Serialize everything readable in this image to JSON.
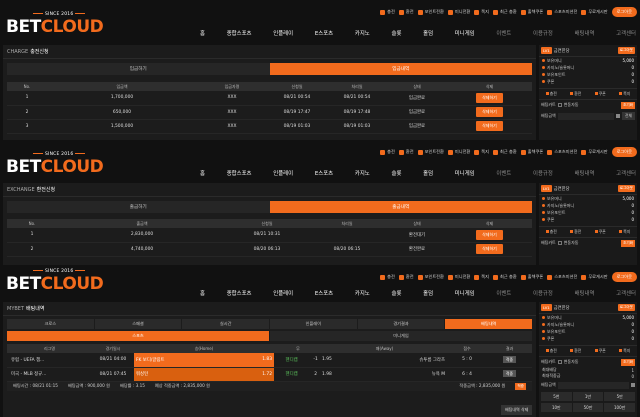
{
  "topbar": {
    "items": [
      "충전",
      "환전",
      "포인트전환",
      "미니전환",
      "쪽지",
      "최근 충환",
      "출첵쿠폰",
      "스포츠미션전",
      "무료게시판"
    ],
    "login": "로그아웃"
  },
  "logo": {
    "since": "SINCE 2016",
    "bet": "BET",
    "cloud": "CLOUD"
  },
  "nav": [
    "홈",
    "종합스포츠",
    "인플레이",
    "E스포츠",
    "카지노",
    "슬롯",
    "홀덤",
    "미니게임",
    "이벤트",
    "이용규정",
    "배팅내역",
    "고객센터"
  ],
  "section1": {
    "title_en": "CHARGE",
    "title_ko": "충전신청",
    "tab_left": "입금하기",
    "tab_right": "입금내역",
    "headers": [
      "No.",
      "입금액",
      "입금자명",
      "신청일",
      "처리일",
      "상태",
      "삭제"
    ],
    "rows": [
      [
        "1",
        "1,700,000",
        "XXX",
        "08/21 00:54",
        "08/21 00:54",
        "입금완료",
        "삭제하기"
      ],
      [
        "2",
        "650,000",
        "XXX",
        "08/19 17:47",
        "08/19 17:48",
        "입금완료",
        "삭제하기"
      ],
      [
        "3",
        "1,500,000",
        "XXX",
        "08/19 01:03",
        "08/19 01:03",
        "입금완료",
        "삭제하기"
      ]
    ]
  },
  "section2": {
    "title_en": "EXCHANGE",
    "title_ko": "환전신청",
    "tab_left": "출금하기",
    "tab_right": "출금내역",
    "headers": [
      "No.",
      "출금액",
      "신청일",
      "처리일",
      "상태",
      "삭제"
    ],
    "rows": [
      [
        "1",
        "2,830,000",
        "08/21 10:31",
        "",
        "환전대기",
        "삭제하기"
      ],
      [
        "2",
        "4,740,000",
        "08/20 06:13",
        "08/20 06:15",
        "환전완료",
        "삭제하기"
      ]
    ]
  },
  "section3": {
    "title_en": "MYBET",
    "title_ko": "배팅내역",
    "subtabs": [
      "크로스",
      "스페셜",
      "실시간",
      "인플레이",
      "경기결과",
      "배팅내역"
    ],
    "sport_tabs": [
      "스포츠",
      "미니게임"
    ],
    "headers": [
      "리그명",
      "경기일시",
      "승(Home)",
      "무",
      "패(Away)",
      "점수",
      "결과"
    ],
    "rows": [
      {
        "league": "유럽 - UEFA 챔...",
        "time": "08/21 04:00",
        "home": "FK 보디/글림트",
        "home_odd": "1.83",
        "line1": "핸디캡",
        "line2": "-1",
        "away_odd": "1.95",
        "away": "슈투름 그라츠",
        "score": "5 : 0",
        "result": "적중"
      },
      {
        "league": "미국 - MLB 정규...",
        "time": "08/21 07:45",
        "home": "워싱턴",
        "home_odd": "1.72",
        "line1": "핸디캡",
        "line2": "2",
        "away_odd": "1.98",
        "away": "뉴욕 M",
        "score": "6 : 4",
        "result": "적중"
      }
    ],
    "summary": {
      "bet_time": "배팅시간 : 08/21 01:15",
      "bet_amount": "배팅금액 : 900,000 원",
      "rate": "배당률 : 3.15",
      "expected": "예상 적중금액 : 2,835,000 원",
      "actual": "적중금액 : 2,835,000 원",
      "status": "적중"
    },
    "bottom_btn": "배팅내역 삭제"
  },
  "sidebar": {
    "level": "LV1",
    "nickname": "금연한당",
    "logout": "로그아웃",
    "rows": [
      {
        "label": "보유머니",
        "value": "5,000"
      },
      {
        "label": "카지노/슬롯머니",
        "value": "0"
      },
      {
        "label": "보유포인트",
        "value": "0"
      },
      {
        "label": "쿠폰",
        "value": "0"
      }
    ],
    "quick": [
      "충전",
      "환전",
      "쿠폰",
      "쪽지"
    ],
    "cart_label": "배팅카트",
    "cart_fix": "변동자동",
    "cart_reset": "초기화",
    "bet_amount_label": "배팅금액",
    "bet_all": "전체",
    "max_rate_label": "최대배당",
    "max_win_label": "최대적중금",
    "max_rate": "1",
    "max_win": "0",
    "chips": [
      "5천",
      "1만",
      "5만",
      "10만",
      "50만",
      "100만"
    ]
  }
}
